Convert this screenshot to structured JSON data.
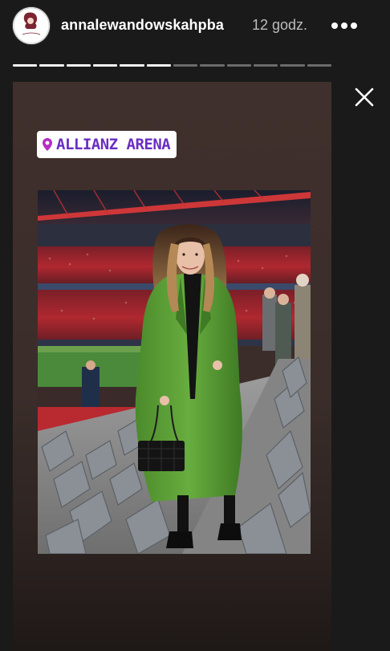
{
  "header": {
    "username": "annalewandowskahpba",
    "time_ago": "12 godz.",
    "avatar_icon": "avatar-icon",
    "more_icon": "more-options-icon"
  },
  "progress": {
    "total_segments": 12,
    "completed_segments": 6
  },
  "close_icon": "close-icon",
  "story": {
    "location_sticker": "ALLIANZ ARENA",
    "location_icon": "location-pin-icon",
    "photo_alt": "photo"
  },
  "colors": {
    "sticker_text": "#6a2ec2",
    "coat": "#5fa13a",
    "stadium_red": "#c8272c"
  }
}
